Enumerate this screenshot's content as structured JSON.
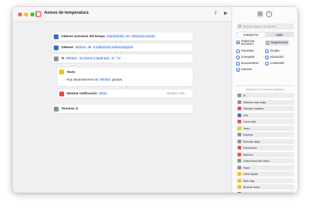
{
  "window": {
    "title": "Avisos de temperatura"
  },
  "workflow": {
    "weather": {
      "label": "Obtener previsión del tiempo",
      "token1": "Diariamente",
      "word_en": "en",
      "token2": "Ubicación actual"
    },
    "get": {
      "label": "Obtener",
      "token1": "Mínima",
      "word_de": "de",
      "token2": "Condiciones meteorológicas"
    },
    "if": {
      "label": "Si",
      "token1": "Mínima",
      "condition": "es menor o igual que",
      "token2": "5",
      "token3": "°C"
    },
    "text": {
      "label": "Texto",
      "body_prefix": "Hoy alcanzaremos los",
      "body_token": "Mínima",
      "body_suffix": "grados."
    },
    "notify": {
      "label": "Mostrar notificación",
      "token": "Texto",
      "more": "Mostrar más"
    },
    "end_if": {
      "label": "Terminar si"
    }
  },
  "sidebar": {
    "search_placeholder": "Buscar apps y acciones",
    "seg_categories": "Categorías",
    "seg_apps": "Apps",
    "categories_left": [
      "Todas las acciones",
      "Favoritas",
      "Compartir",
      "Documentos",
      "Internet"
    ],
    "categories_right": [
      "Sugerencias",
      "Scripts",
      "Ubicación",
      "Contenido"
    ],
    "section_label": "Sugerencias de acciones siguientes",
    "actions": [
      "Si",
      "Obtener este atajo",
      "Obtener variable",
      "URL",
      "Crear lista",
      "Texto",
      "Esperar",
      "Ejecutar atajo",
      "Diccionario",
      "Número",
      "Seleccionar del menú",
      "Nada",
      "Vista rápida",
      "Abrir app",
      "Mostrar aviso",
      "Obtener archivo"
    ],
    "action_colors": [
      "#8e8e93",
      "#8e8e93",
      "#e94b46",
      "#3d6fb8",
      "#e94b46",
      "#f0c417",
      "#8e8e93",
      "#8e8e93",
      "#e94b46",
      "#e94b46",
      "#8e8e93",
      "#8e8e93",
      "#f0c417",
      "#f0c417",
      "#f0c417",
      "#3d6fb8"
    ]
  }
}
